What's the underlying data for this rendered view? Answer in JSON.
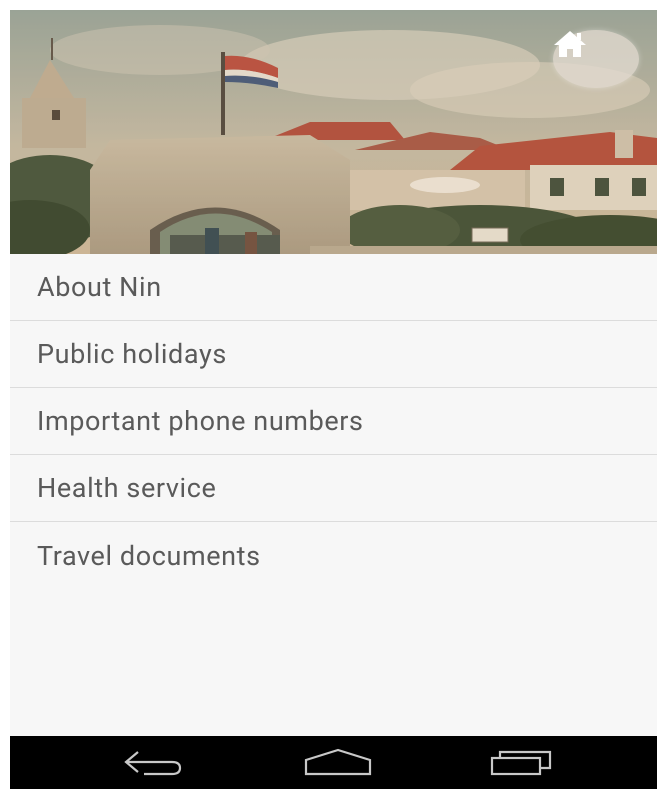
{
  "header": {
    "image_description": "Photo of the old town gate of Nin with a Croatian flag, red-roofed houses and cloudy sky",
    "home_icon": "home-icon"
  },
  "menu": {
    "items": [
      {
        "label": "About Nin"
      },
      {
        "label": "Public holidays"
      },
      {
        "label": "Important phone numbers"
      },
      {
        "label": "Health service"
      },
      {
        "label": "Travel documents"
      }
    ]
  },
  "navbar": {
    "back_icon": "back-icon",
    "home_icon": "home-outline-icon",
    "recents_icon": "recent-apps-icon"
  },
  "colors": {
    "menu_background": "#f7f7f7",
    "menu_text": "#5a5a5a",
    "divider": "#dcdcdc",
    "navbar": "#000000"
  }
}
